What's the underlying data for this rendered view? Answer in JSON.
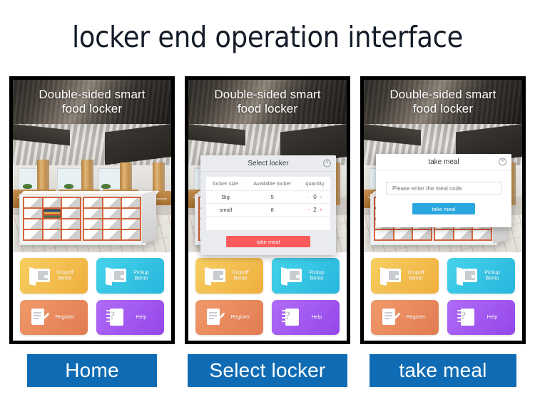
{
  "page": {
    "title": "locker end operation interface"
  },
  "kiosk": {
    "header_title_line1": "Double-sided smart",
    "header_title_line2": "food locker",
    "tiles": [
      {
        "label_line1": "Dropoff",
        "label_line2": "Bento",
        "icon": "locker-open-door-icon",
        "color": "#f5c453"
      },
      {
        "label_line1": "Pickup",
        "label_line2": "Bento",
        "icon": "locker-open-door-icon",
        "color": "#3ec8e8"
      },
      {
        "label_line1": "Register",
        "label_line2": "",
        "icon": "document-pen-icon",
        "color": "#ef8c5f"
      },
      {
        "label_line1": "Help",
        "label_line2": "",
        "icon": "book-question-icon",
        "color": "#a45cf0"
      }
    ]
  },
  "panels": [
    {
      "caption": "Home"
    },
    {
      "caption": "Select locker"
    },
    {
      "caption": "take meal"
    }
  ],
  "select_locker_dialog": {
    "title": "Select locker",
    "close_icon": "close-circle-icon",
    "columns": [
      "locker size",
      "Available locker",
      "quantity"
    ],
    "rows": [
      {
        "size": "Big",
        "available": "5",
        "minus": "−",
        "quantity": "0",
        "plus": "+",
        "highlighted": false
      },
      {
        "size": "small",
        "available": "8",
        "minus": "−",
        "quantity": "2",
        "plus": "+",
        "highlighted": true
      }
    ],
    "submit_label": "take meal",
    "submit_color": "#fb5b5b"
  },
  "take_meal_dialog": {
    "title": "take meal",
    "close_icon": "close-circle-icon",
    "input_placeholder": "Please enter the meal code",
    "input_value": "",
    "submit_label": "take meal",
    "submit_color": "#2ba7e0"
  },
  "colors": {
    "caption_bar": "#0f6cb4",
    "page_title": "#141c29",
    "locker_orange": "#d2653c"
  }
}
